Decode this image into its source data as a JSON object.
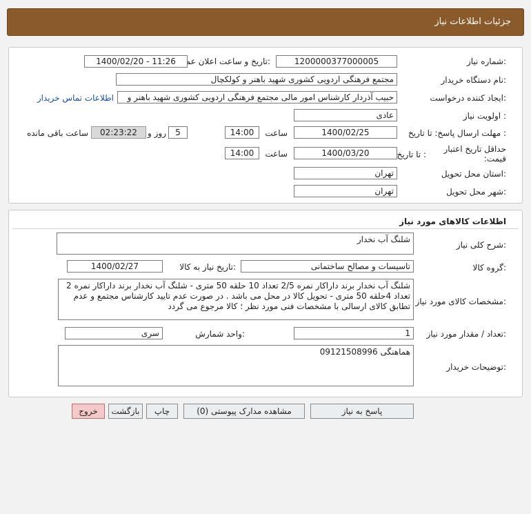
{
  "header": {
    "title": "جزئیات اطلاعات نیاز"
  },
  "need_info": {
    "need_number_label": "شماره نیاز:",
    "need_number": "1200000377000005",
    "announce_label": "تاریخ و ساعت اعلان عمومی:",
    "announce_value": "1400/02/20 - 11:26",
    "buyer_org_label": "نام دستگاه خریدار:",
    "buyer_org": "مجتمع فرهنگی اردویی کشوری شهید باهنر و کولکچال",
    "requester_label": "ایجاد کننده درخواست:",
    "requester": "حبیب آذردار کارشناس امور مالی  مجتمع فرهنگی اردویی کشوری شهید باهنر و",
    "contact_link": "اطلاعات تماس خریدار",
    "priority_label": "اولویت نیاز :",
    "priority": "عادی",
    "deadline_label": "مهلت ارسال پاسخ: تا تاریخ :",
    "deadline_date": "1400/02/25",
    "time_word": "ساعت",
    "deadline_time": "14:00",
    "days_value": "5",
    "days_and": "روز و",
    "remaining_time": "02:23:22",
    "remaining_label": "ساعت باقی مانده",
    "validity_label": "حداقل تاریخ اعتبار قیمت:",
    "validity_to": "تا تاریخ :",
    "validity_date": "1400/03/20",
    "validity_time": "14:00",
    "province_label": "استان محل تحویل:",
    "province": "تهران",
    "city_label": "شهر محل تحویل:",
    "city": "تهران"
  },
  "goods": {
    "section_title": "اطلاعات کالاهای مورد نیاز",
    "summary_label": "شرح کلی نیاز:",
    "summary": "شلنگ آب نخدار",
    "group_label": "گروه کالا:",
    "group": "تاسیسات و مصالح ساختمانی",
    "need_date_label": "تاریخ نیاز به کالا:",
    "need_date": "1400/02/27",
    "spec_label": "مشخصات کالای مورد نیاز:",
    "spec": "شلنگ آب نخدار برند داراکار نمره 2/5 تعداد 10 حلقه 50 متری - شلنگ آب نخدار برند داراکار نمره 2 تعداد 4حلقه 50 متری - تحویل کالا در محل می باشد . در صورت عدم تایید کارشناس مجتمع و عدم تطابق کالای ارسالی با مشخصات فنی مورد نظر ؛ کالا مرجوع می گردد",
    "qty_label": "تعداد / مقدار مورد نیاز:",
    "qty": "1",
    "unit_label": "واحد شمارش:",
    "unit": "سری",
    "buyer_notes_label": "توضیحات خریدار:",
    "buyer_notes": "هماهنگی 09121508996"
  },
  "buttons": {
    "reply": "پاسخ به نیاز",
    "attachments": "مشاهده مدارک پیوستی (0)",
    "print": "چاپ",
    "back": "بازگشت",
    "exit": "خروج"
  }
}
